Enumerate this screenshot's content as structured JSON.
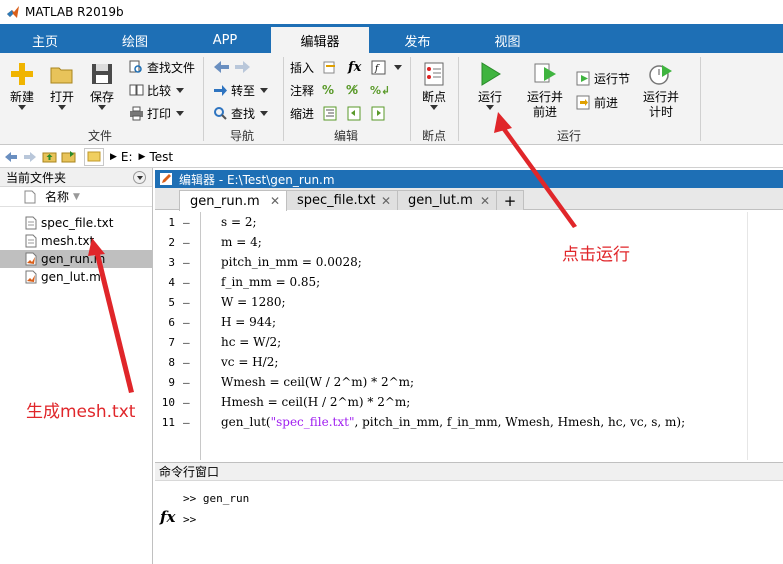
{
  "window": {
    "title": "MATLAB R2019b"
  },
  "tabs": [
    {
      "label": "主页"
    },
    {
      "label": "绘图"
    },
    {
      "label": "APP"
    },
    {
      "label": "编辑器"
    },
    {
      "label": "发布"
    },
    {
      "label": "视图"
    }
  ],
  "ribbon": {
    "file": {
      "new": "新建",
      "open": "打开",
      "save": "保存",
      "find_files": "查找文件",
      "compare": "比较",
      "print": "打印",
      "group": "文件"
    },
    "nav": {
      "goto": "转至",
      "find": "查找",
      "group": "导航"
    },
    "edit": {
      "insert": "插入",
      "comment": "注释",
      "indent": "缩进",
      "fx": "fx",
      "group": "编辑"
    },
    "breakpoints": {
      "label": "断点",
      "group": "断点"
    },
    "run": {
      "run": "运行",
      "run_advance_1": "运行并",
      "run_advance_2": "前进",
      "run_section": "运行节",
      "advance": "前进",
      "run_time_1": "运行并",
      "run_time_2": "计时",
      "group": "运行"
    }
  },
  "address": {
    "drive": "E:",
    "folder": "Test"
  },
  "file_browser": {
    "title": "当前文件夹",
    "column": "名称",
    "files": [
      "spec_file.txt",
      "mesh.txt",
      "gen_run.m",
      "gen_lut.m"
    ],
    "selected_index": 2
  },
  "editor": {
    "title": "编辑器 - E:\\Test\\gen_run.m",
    "tabs": [
      "gen_run.m",
      "spec_file.txt",
      "gen_lut.m"
    ],
    "active_tab": 0,
    "lines": [
      {
        "n": "1",
        "code": "s = 2;"
      },
      {
        "n": "2",
        "code": "m = 4;"
      },
      {
        "n": "3",
        "code": "pitch_in_mm = 0.0028;"
      },
      {
        "n": "4",
        "code": "f_in_mm = 0.85;"
      },
      {
        "n": "5",
        "code": "W = 1280;"
      },
      {
        "n": "6",
        "code": "H = 944;"
      },
      {
        "n": "7",
        "code": "hc = W/2;"
      },
      {
        "n": "8",
        "code": "vc = H/2;"
      },
      {
        "n": "9",
        "code": "Wmesh = ceil(W / 2^m) * 2^m;"
      },
      {
        "n": "10",
        "code": "Hmesh = ceil(H / 2^m) * 2^m;"
      },
      {
        "n": "11",
        "code_pre": "gen_lut(",
        "code_str": "\"spec_file.txt\"",
        "code_post": ", pitch_in_mm, f_in_mm, Wmesh, Hmesh, hc, vc, s, m);"
      }
    ]
  },
  "command_window": {
    "title": "命令行窗口",
    "history": ">> gen_run",
    "prompt": ">>",
    "fx": "fx"
  },
  "annotations": {
    "click_run": "点击运行",
    "generate_mesh": "生成mesh.txt"
  },
  "colors": {
    "accent": "#1e6fb5",
    "annotation": "#e0262a",
    "string": "#a020f0"
  }
}
